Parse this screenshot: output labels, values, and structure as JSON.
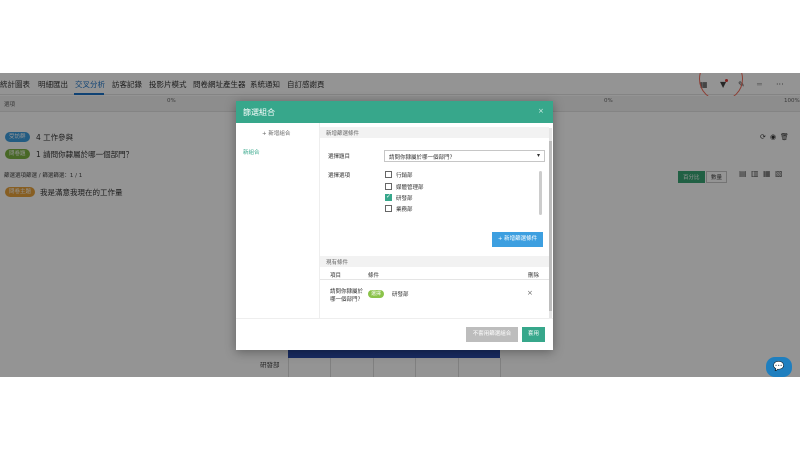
{
  "tabs": [
    {
      "label": "統計圖表"
    },
    {
      "label": "明細匯出"
    },
    {
      "label": "交叉分析"
    },
    {
      "label": "訪客記錄"
    },
    {
      "label": "投影片模式"
    },
    {
      "label": "問卷網址產生器"
    },
    {
      "label": "系統通知"
    },
    {
      "label": "自訂感謝頁"
    }
  ],
  "toolbar": {
    "more": "···",
    "menu": "═"
  },
  "row_bar": {
    "header": "選項",
    "p1": "0%",
    "p2": "0%",
    "p3": "100%"
  },
  "tags": {
    "segment": "受訪群",
    "question": "問卷題",
    "topic": "問卷主題"
  },
  "lines": {
    "segment_text": "4 工作參與",
    "question_text": "1 請問你隸屬於哪一個部門？",
    "filter_count": "篩選選項篩選 / 篩選篩選：1 / 1",
    "topic_text": "我是滿意我現在的工作量"
  },
  "pills": {
    "percent": "百分比",
    "count": "數量"
  },
  "bottom": {
    "label": "研發部"
  },
  "modal": {
    "title": "篩選組合",
    "close": "×",
    "add_group": "+ 新增組合",
    "group_item": "新組合",
    "add_condition_section": "新增篩選條件",
    "select_question_label": "選擇題目",
    "select_question_value": "請問你隸屬於哪一個部門？",
    "select_option_label": "選擇選項",
    "options": [
      {
        "label": "行銷部",
        "checked": false
      },
      {
        "label": "媒體管理部",
        "checked": false
      },
      {
        "label": "研發部",
        "checked": true
      },
      {
        "label": "業務部",
        "checked": false
      },
      {
        "label": "...",
        "checked": false
      }
    ],
    "add_condition_button": "+ 新增篩選條件",
    "existing_section": "現有條件",
    "table_head": {
      "item": "項目",
      "condition": "條件",
      "delete": "刪除"
    },
    "table_row": {
      "item": "請問你隸屬於哪一個部門？",
      "tag": "選擇",
      "condition": "研發部",
      "delete": "×"
    },
    "btn_no_filter": "不套用篩選組合",
    "btn_apply": "套用"
  }
}
